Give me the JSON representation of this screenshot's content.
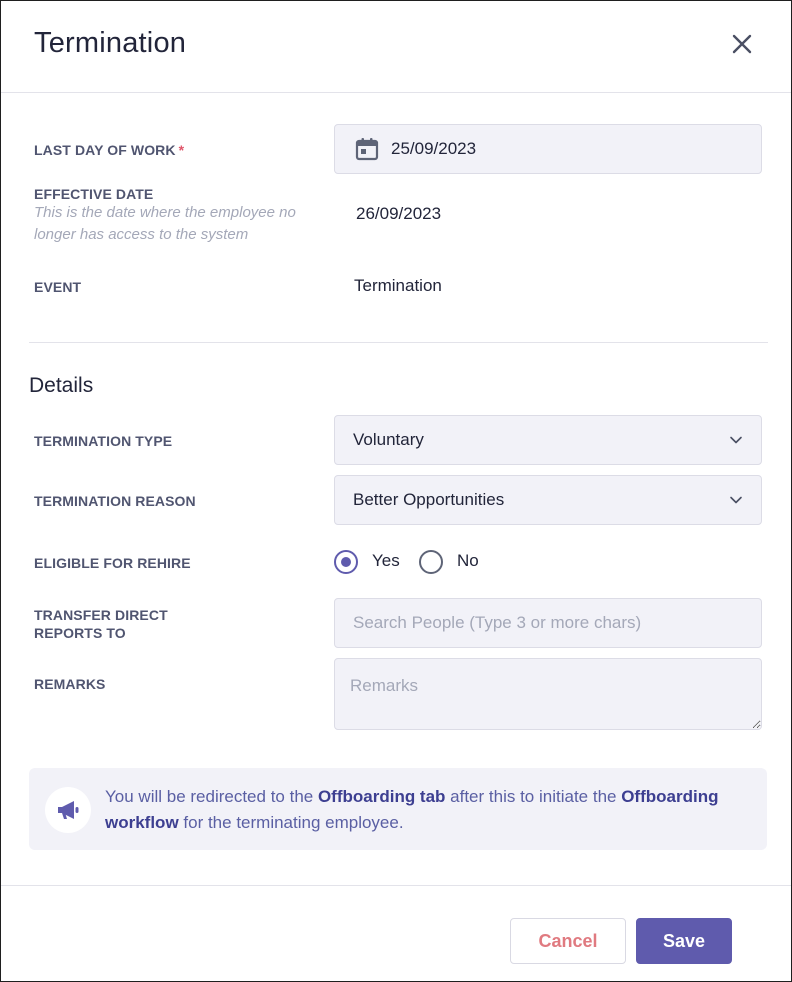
{
  "dialog": {
    "title": "Termination"
  },
  "fields": {
    "last_day_of_work": {
      "label": "LAST DAY OF WORK",
      "required_mark": "*",
      "value": "25/09/2023"
    },
    "effective_date": {
      "label": "EFFECTIVE DATE",
      "hint": "This is the date where the employee no longer has access to the system",
      "value": "26/09/2023"
    },
    "event": {
      "label": "EVENT",
      "value": "Termination"
    }
  },
  "details": {
    "section_title": "Details",
    "termination_type": {
      "label": "TERMINATION TYPE",
      "value": "Voluntary"
    },
    "termination_reason": {
      "label": "TERMINATION REASON",
      "value": "Better Opportunities"
    },
    "eligible_for_rehire": {
      "label": "ELIGIBLE FOR REHIRE",
      "options": [
        "Yes",
        "No"
      ],
      "selected": "Yes"
    },
    "transfer_direct_reports": {
      "label_line1": "TRANSFER DIRECT",
      "label_line2": "REPORTS TO",
      "placeholder": "Search People (Type 3 or more chars)"
    },
    "remarks": {
      "label": "REMARKS",
      "placeholder": "Remarks"
    }
  },
  "notice": {
    "part1": "You will be redirected to the ",
    "bold1": "Offboarding tab",
    "part2": " after this to initiate the ",
    "bold2": "Offboarding workflow",
    "part3": " for the terminating employee."
  },
  "footer": {
    "cancel_label": "Cancel",
    "save_label": "Save"
  },
  "colors": {
    "accent": "#5f5bad",
    "cancel_text": "#e07a80",
    "field_bg": "#f2f2f8"
  }
}
